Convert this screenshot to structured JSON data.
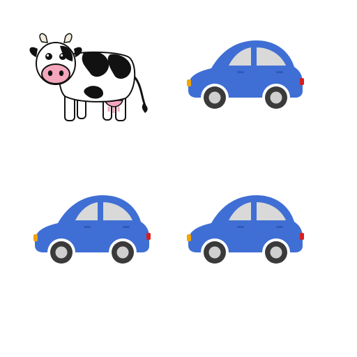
{
  "colors": {
    "background": "#ffffff",
    "car_body": "#3f6fd4",
    "car_body_dark": "#2f59b5",
    "car_window": "#d9d9d9",
    "tire": "#3a3a3a",
    "hub": "#cfcfcf",
    "headlight": "#f2a500",
    "taillight": "#d61f1f",
    "cow_white": "#ffffff",
    "cow_black": "#111111",
    "cow_nose": "#f4a6bd",
    "cow_horn": "#f2eadc"
  },
  "grid": {
    "tiles": [
      {
        "kind": "cow",
        "icon": "cow-icon"
      },
      {
        "kind": "car",
        "icon": "car-icon"
      },
      {
        "kind": "car",
        "icon": "car-icon"
      },
      {
        "kind": "car",
        "icon": "car-icon"
      }
    ]
  }
}
